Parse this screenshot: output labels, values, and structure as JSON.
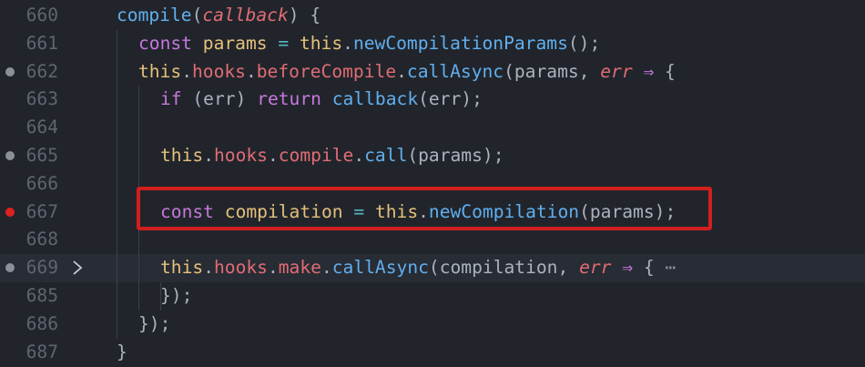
{
  "editor": {
    "lines": [
      {
        "no": "660",
        "dot": "",
        "fold": false,
        "tokens": [
          {
            "t": "compile",
            "c": "fn"
          },
          {
            "t": "(",
            "c": "pun"
          },
          {
            "t": "callback",
            "c": "param"
          },
          {
            "t": ") {",
            "c": "pun"
          }
        ]
      },
      {
        "no": "661",
        "dot": "",
        "fold": false,
        "tokens": [
          {
            "t": "const ",
            "c": "kw"
          },
          {
            "t": "params",
            "c": "var"
          },
          {
            "t": " = ",
            "c": "op"
          },
          {
            "t": "this",
            "c": "this"
          },
          {
            "t": ".",
            "c": "pun"
          },
          {
            "t": "newCompilationParams",
            "c": "fn"
          },
          {
            "t": "();",
            "c": "pun"
          }
        ]
      },
      {
        "no": "662",
        "dot": "gray",
        "fold": false,
        "tokens": [
          {
            "t": "this",
            "c": "this"
          },
          {
            "t": ".",
            "c": "pun"
          },
          {
            "t": "hooks",
            "c": "prop"
          },
          {
            "t": ".",
            "c": "pun"
          },
          {
            "t": "beforeCompile",
            "c": "prop"
          },
          {
            "t": ".",
            "c": "pun"
          },
          {
            "t": "callAsync",
            "c": "fn"
          },
          {
            "t": "(params, ",
            "c": "pun"
          },
          {
            "t": "err",
            "c": "param"
          },
          {
            "t": " ⇒ ",
            "c": "arrow"
          },
          {
            "t": "{",
            "c": "pun"
          }
        ]
      },
      {
        "no": "663",
        "dot": "",
        "fold": false,
        "tokens": [
          {
            "t": "if ",
            "c": "kw"
          },
          {
            "t": "(err) ",
            "c": "pun"
          },
          {
            "t": "return ",
            "c": "kw"
          },
          {
            "t": "callback",
            "c": "fn"
          },
          {
            "t": "(err);",
            "c": "pun"
          }
        ]
      },
      {
        "no": "664",
        "dot": "",
        "fold": false,
        "tokens": []
      },
      {
        "no": "665",
        "dot": "gray",
        "fold": false,
        "tokens": [
          {
            "t": "this",
            "c": "this"
          },
          {
            "t": ".",
            "c": "pun"
          },
          {
            "t": "hooks",
            "c": "prop"
          },
          {
            "t": ".",
            "c": "pun"
          },
          {
            "t": "compile",
            "c": "prop"
          },
          {
            "t": ".",
            "c": "pun"
          },
          {
            "t": "call",
            "c": "fn"
          },
          {
            "t": "(params);",
            "c": "pun"
          }
        ]
      },
      {
        "no": "666",
        "dot": "",
        "fold": false,
        "tokens": []
      },
      {
        "no": "667",
        "dot": "red",
        "fold": false,
        "tokens": [
          {
            "t": "const ",
            "c": "kw"
          },
          {
            "t": "compilation",
            "c": "var"
          },
          {
            "t": " = ",
            "c": "op"
          },
          {
            "t": "this",
            "c": "this"
          },
          {
            "t": ".",
            "c": "pun"
          },
          {
            "t": "newCompilation",
            "c": "fn"
          },
          {
            "t": "(params);",
            "c": "pun"
          }
        ]
      },
      {
        "no": "668",
        "dot": "",
        "fold": false,
        "tokens": []
      },
      {
        "no": "669",
        "dot": "gray",
        "fold": true,
        "current": true,
        "tokens": [
          {
            "t": "this",
            "c": "this"
          },
          {
            "t": ".",
            "c": "pun"
          },
          {
            "t": "hooks",
            "c": "prop"
          },
          {
            "t": ".",
            "c": "pun"
          },
          {
            "t": "make",
            "c": "prop"
          },
          {
            "t": ".",
            "c": "pun"
          },
          {
            "t": "callAsync",
            "c": "fn"
          },
          {
            "t": "(compilation, ",
            "c": "pun"
          },
          {
            "t": "err",
            "c": "param"
          },
          {
            "t": " ⇒ ",
            "c": "arrow"
          },
          {
            "t": "{",
            "c": "pun"
          },
          {
            "t": " ⋯",
            "c": "ellipsis"
          }
        ]
      },
      {
        "no": "685",
        "dot": "",
        "fold": false,
        "tokens": [
          {
            "t": "});",
            "c": "pun"
          }
        ]
      },
      {
        "no": "686",
        "dot": "",
        "fold": false,
        "tokens": [
          {
            "t": "});",
            "c": "pun"
          }
        ]
      },
      {
        "no": "687",
        "dot": "",
        "fold": false,
        "tokens": [
          {
            "t": "}",
            "c": "pun"
          }
        ]
      }
    ]
  },
  "colors": {
    "background": "#21252b",
    "highlight_border": "#d11f1f",
    "breakpoint": "#e02020"
  }
}
